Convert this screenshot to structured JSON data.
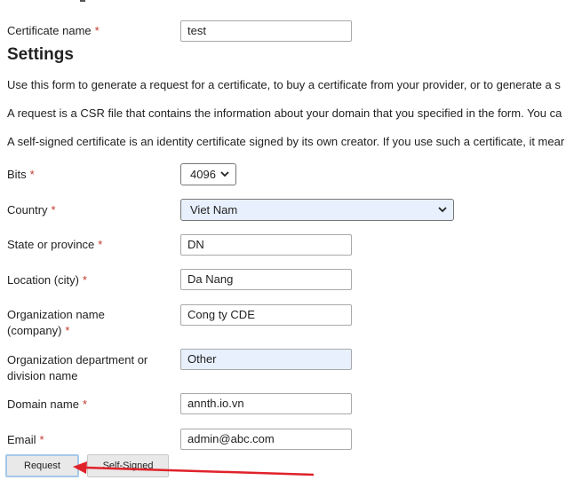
{
  "form": {
    "certificate_name": {
      "label": "Certificate name",
      "required_mark": "*",
      "value": "test"
    },
    "settings_heading": "Settings",
    "paragraphs": [
      "Use this form to generate a request for a certificate, to buy a certificate from your provider, or to generate a s",
      "A request is a CSR file that contains the information about your domain that you specified in the form. You ca",
      "A self-signed certificate is an identity certificate signed by its own creator. If you use such a certificate, it mear"
    ],
    "bits": {
      "label": "Bits",
      "required_mark": "*",
      "value": "4096"
    },
    "country": {
      "label": "Country",
      "required_mark": "*",
      "value": "Viet Nam"
    },
    "state": {
      "label": "State or province",
      "required_mark": "*",
      "value": "DN"
    },
    "location": {
      "label": "Location (city)",
      "required_mark": "*",
      "value": "Da Nang"
    },
    "organization": {
      "label_line1": "Organization name",
      "label_line2": "(company)",
      "required_mark": "*",
      "value": "Cong ty CDE"
    },
    "department": {
      "label_line1": "Organization department or",
      "label_line2": "division name",
      "value": "Other"
    },
    "domain": {
      "label": "Domain name",
      "required_mark": "*",
      "value": "annth.io.vn"
    },
    "email": {
      "label": "Email",
      "required_mark": "*",
      "value": "admin@abc.com"
    }
  },
  "buttons": {
    "request": "Request",
    "self_signed": "Self-Signed"
  },
  "colors": {
    "required": "#c0392b",
    "autofill_bg": "#e8f0fe",
    "annotation_arrow": "#e0222a"
  },
  "icons": {
    "select_chevron": "chevron-down-icon",
    "annotation": "arrow-left-icon"
  }
}
